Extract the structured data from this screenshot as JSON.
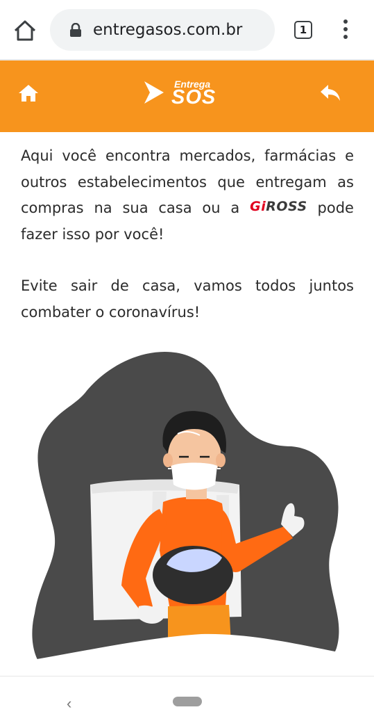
{
  "browser": {
    "url": "entregasos.com.br",
    "tab_count": "1"
  },
  "header": {
    "logo_small": "Entrega",
    "logo_big": "SOS",
    "brand_color": "#f7941d"
  },
  "content": {
    "p1_before": "Aqui você encontra mercados, farmácias e outros estabelecimentos que entregam as compras na sua casa ou a",
    "giross_logo": "GiROSS",
    "p1_after": "pode fazer isso por você!",
    "p2": "Evite sair de casa, vamos todos juntos combater o coronavírus!"
  },
  "icons": {
    "browser_home": "home-outline-icon",
    "lock": "lock-icon",
    "menu": "more-vert-icon",
    "header_home": "home-icon",
    "header_back": "reply-back-icon",
    "nav_back": "chevron-left-icon"
  }
}
